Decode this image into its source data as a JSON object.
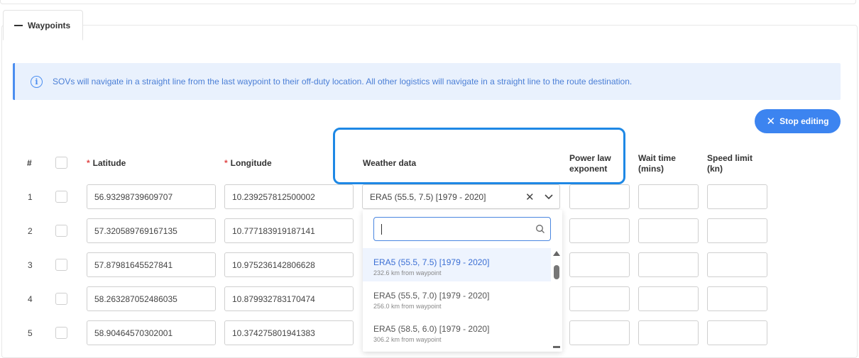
{
  "section": {
    "title": "Waypoints"
  },
  "info": {
    "message": "SOVs will navigate in a straight line from the last waypoint to their off-duty location. All other logistics will navigate in a straight line to the route destination."
  },
  "stop_editing_label": "Stop editing",
  "columns": {
    "index": "#",
    "latitude": "Latitude",
    "longitude": "Longitude",
    "weather": "Weather data",
    "power_law_1": "Power law",
    "power_law_2": "exponent",
    "wait_time_1": "Wait time",
    "wait_time_2": "(mins)",
    "speed_limit_1": "Speed limit",
    "speed_limit_2": "(kn)",
    "required_marker": "*"
  },
  "rows": [
    {
      "num": "1",
      "lat": "56.93298739609707",
      "lon": "10.239257812500002"
    },
    {
      "num": "2",
      "lat": "57.320589769167135",
      "lon": "10.777183919187141"
    },
    {
      "num": "3",
      "lat": "57.87981645527841",
      "lon": "10.975236142806628"
    },
    {
      "num": "4",
      "lat": "58.263287052486035",
      "lon": "10.879932783170474"
    },
    {
      "num": "5",
      "lat": "58.90464570302001",
      "lon": "10.374275801941383"
    }
  ],
  "weather_select": {
    "value": "ERA5 (55.5, 7.5) [1979 - 2020]"
  },
  "dropdown": {
    "search_value": "",
    "options": [
      {
        "label": "ERA5 (55.5, 7.5) [1979 - 2020]",
        "sub": "232.6 km from waypoint",
        "selected": true
      },
      {
        "label": "ERA5 (55.5, 7.0) [1979 - 2020]",
        "sub": "256.0 km from waypoint",
        "selected": false
      },
      {
        "label": "ERA5 (58.5, 6.0) [1979 - 2020]",
        "sub": "306.2 km from waypoint",
        "selected": false
      }
    ]
  },
  "colors": {
    "accent": "#3c84f0",
    "highlight": "#1e88e5",
    "info_bg": "#e9f1fd",
    "required": "#e04646"
  }
}
